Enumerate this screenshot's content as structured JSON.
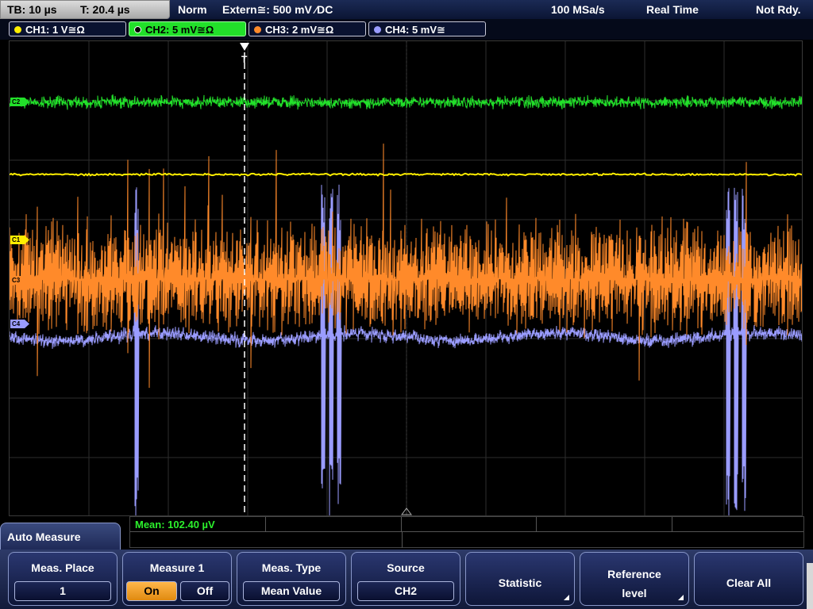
{
  "status": {
    "timebase": "TB: 10 µs",
    "trigger_time": "T: 20.4 µs",
    "mode": "Norm",
    "trigger_source": "Extern≅: 500 mV ⁄DC",
    "sample_rate": "100 MSa/s",
    "acq_mode": "Real Time",
    "state": "Not Rdy."
  },
  "channels": [
    {
      "label": "CH1: 1 V≅Ω",
      "color": "#ffee00",
      "active": false
    },
    {
      "label": "CH2: 5 mV≅Ω",
      "color": "#22e02a",
      "active": true
    },
    {
      "label": "CH3: 2 mV≅Ω",
      "color": "#ff8a2a",
      "active": false
    },
    {
      "label": "CH4: 5 mV≅",
      "color": "#9a9cff",
      "active": false
    }
  ],
  "markers": {
    "c1": "C1",
    "c2": "C2",
    "c3": "C3",
    "c4": "C4",
    "trigger": "T"
  },
  "measurement": {
    "mean": "Mean: 102.40 µV"
  },
  "menu": {
    "title": "Auto Measure",
    "meas_place_label": "Meas. Place",
    "meas_place_value": "1",
    "measure1_label": "Measure 1",
    "on_label": "On",
    "off_label": "Off",
    "meas_type_label": "Meas. Type",
    "meas_type_value": "Mean Value",
    "source_label": "Source",
    "source_value": "CH2",
    "statistic_label": "Statistic",
    "reference_label_1": "Reference",
    "reference_label_2": "level",
    "clear_all_label": "Clear All"
  },
  "colors": {
    "ch1": "#ffee00",
    "ch2": "#22e02a",
    "ch3": "#ff8a2a",
    "ch4": "#9a9cff",
    "grid": "#3a3a3a"
  }
}
